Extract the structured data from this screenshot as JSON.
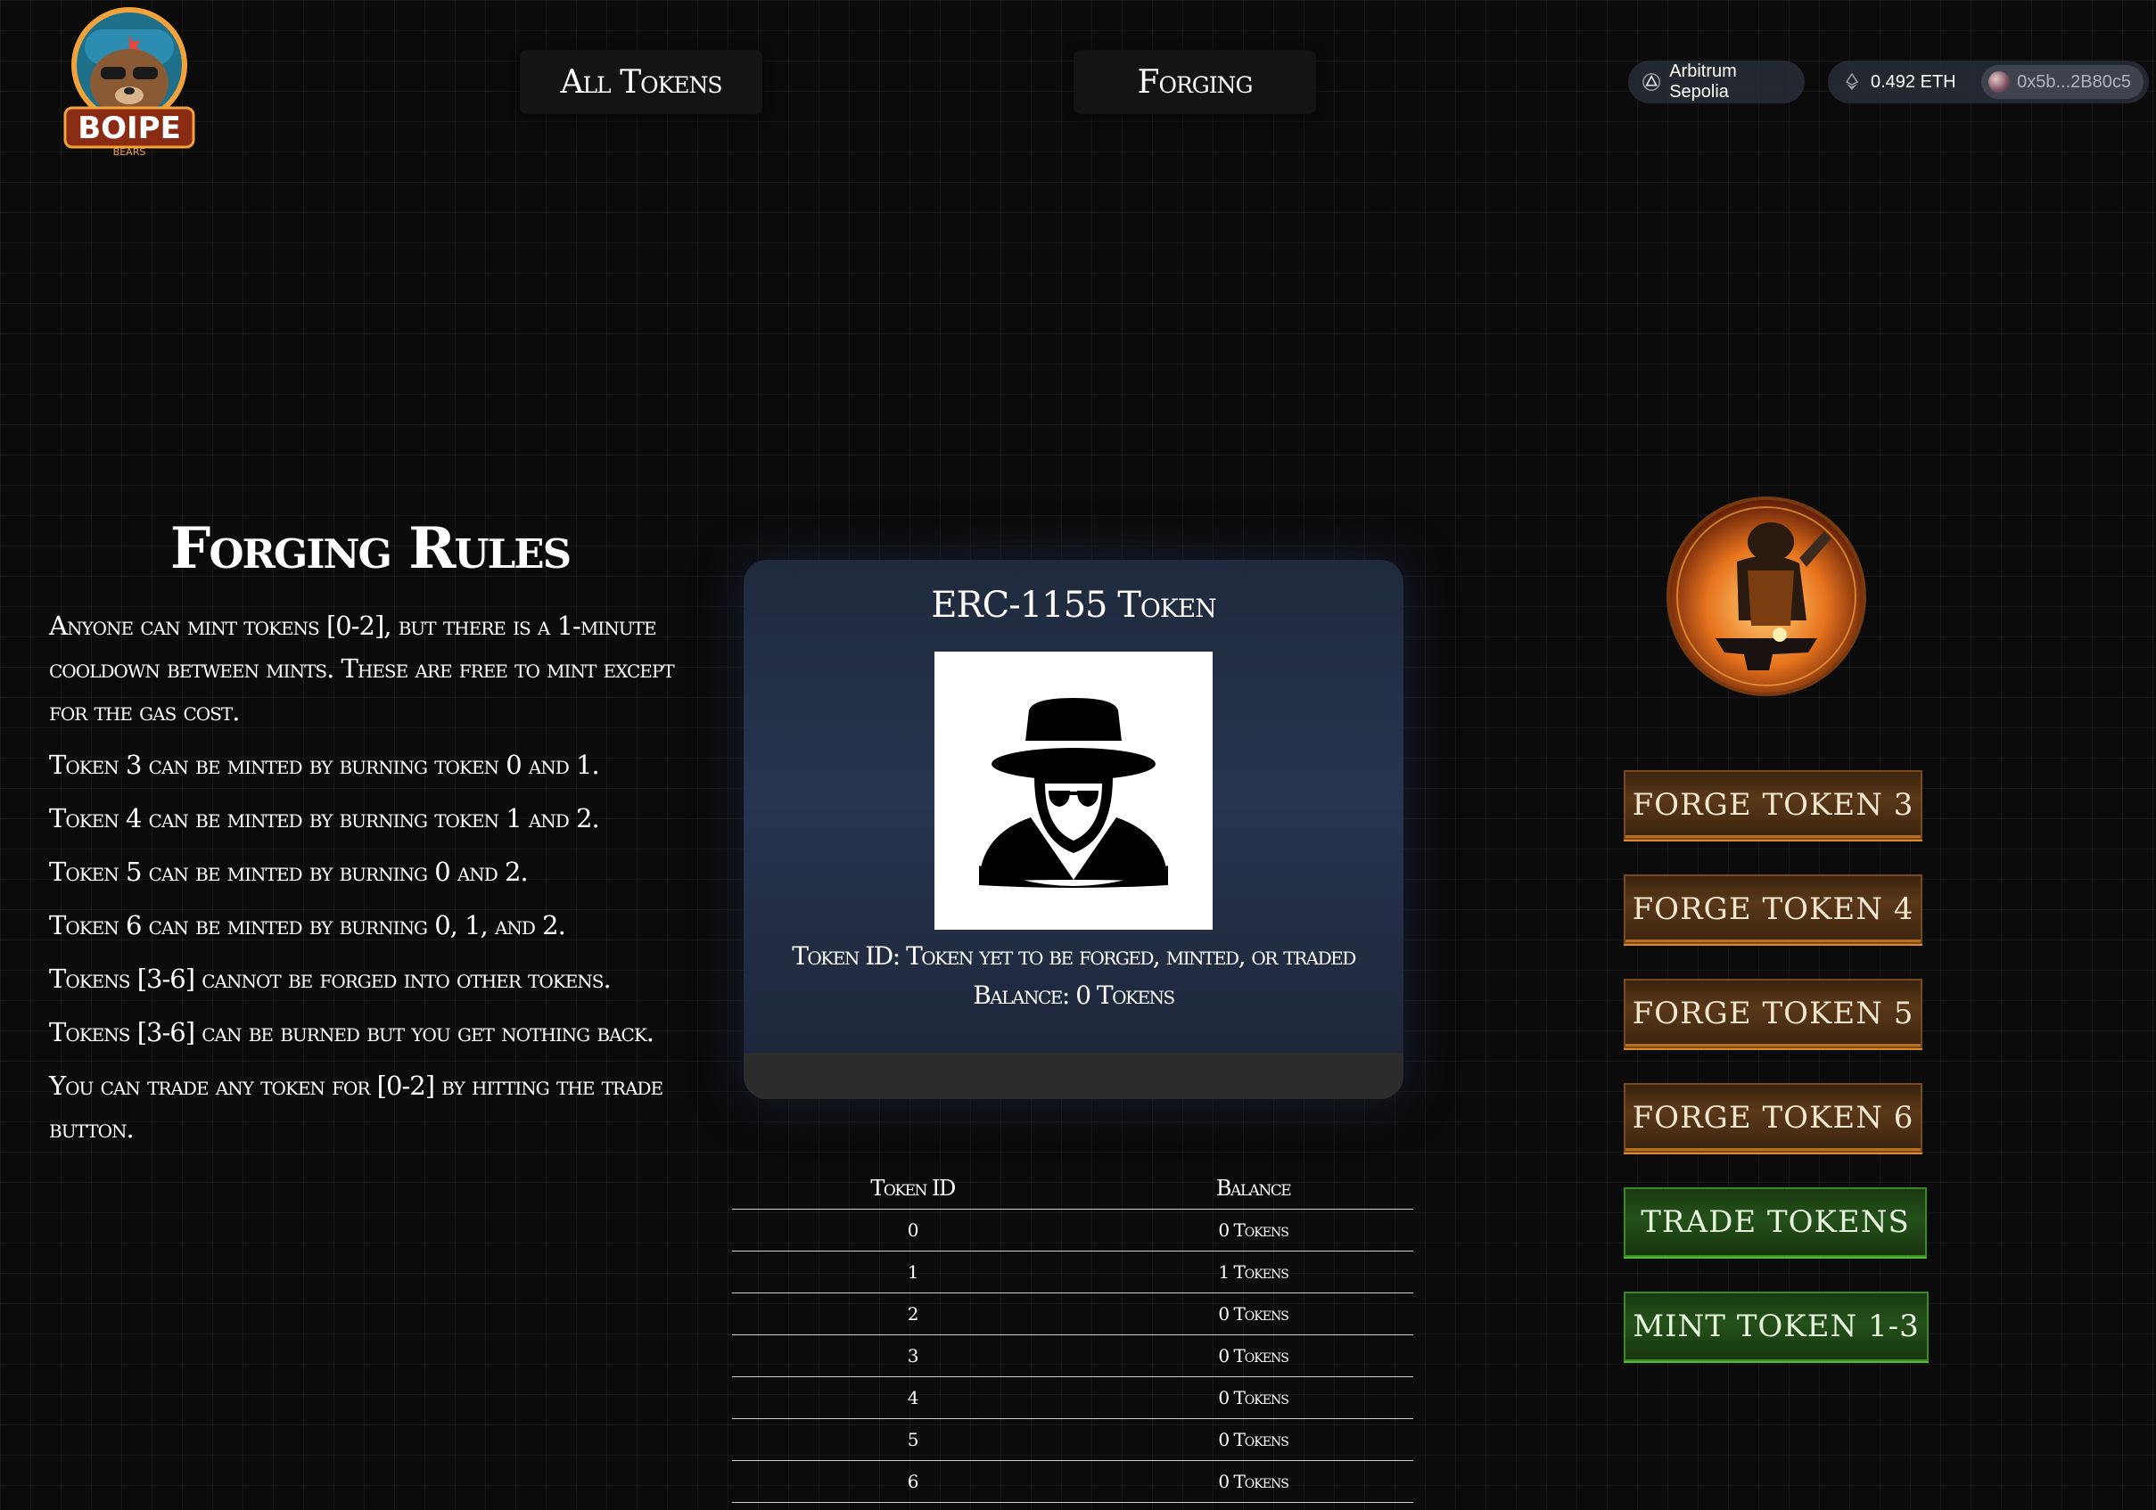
{
  "header": {
    "logo_text": "BOIPE",
    "logo_subtext": "BEARS",
    "nav": [
      {
        "label": "All Tokens"
      },
      {
        "label": "Forging"
      }
    ],
    "network": {
      "icon": "arbitrum-icon",
      "label": "Arbitrum Sepolia"
    },
    "wallet": {
      "icon": "eth-icon",
      "balance": "0.492 ETH",
      "address": "0x5b...2B80c5"
    }
  },
  "rules": {
    "title": "Forging Rules",
    "items": [
      "Anyone can mint tokens [0-2], but there is a 1-minute cooldown between mints. These are free to mint except for the gas cost.",
      "Token 3 can be minted by burning token 0 and 1.",
      "Token 4 can be minted by burning token 1 and 2.",
      "Token 5 can be minted by burning 0 and 2.",
      "Token 6 can be minted by burning 0, 1, and 2.",
      "Tokens [3-6] cannot be forged into other tokens.",
      "Tokens [3-6] can be burned but you get nothing back.",
      "You can trade any token for [0-2] by hitting the trade button."
    ]
  },
  "card": {
    "title": "ERC-1155 Token",
    "image_icon": "anonymous-spy-icon",
    "token_id_line": "Token ID: Token yet to be forged, minted, or traded",
    "balance_line": "Balance: 0 Tokens"
  },
  "table": {
    "headers": [
      "Token ID",
      "Balance"
    ],
    "rows": [
      [
        "0",
        "0 Tokens"
      ],
      [
        "1",
        "1 Tokens"
      ],
      [
        "2",
        "0 Tokens"
      ],
      [
        "3",
        "0 Tokens"
      ],
      [
        "4",
        "0 Tokens"
      ],
      [
        "5",
        "0 Tokens"
      ],
      [
        "6",
        "0 Tokens"
      ]
    ]
  },
  "actions": {
    "forge3": "FORGE TOKEN 3",
    "forge4": "FORGE TOKEN 4",
    "forge5": "FORGE TOKEN 5",
    "forge6": "FORGE TOKEN 6",
    "trade": "TRADE TOKENS",
    "mint": "MINT TOKEN 1-3"
  },
  "colors": {
    "forge_button": "#5a3818",
    "forge_accent": "#e08a2a",
    "green_button": "#24501a",
    "green_accent": "#4fbf2c",
    "background": "#0b0b0b"
  }
}
